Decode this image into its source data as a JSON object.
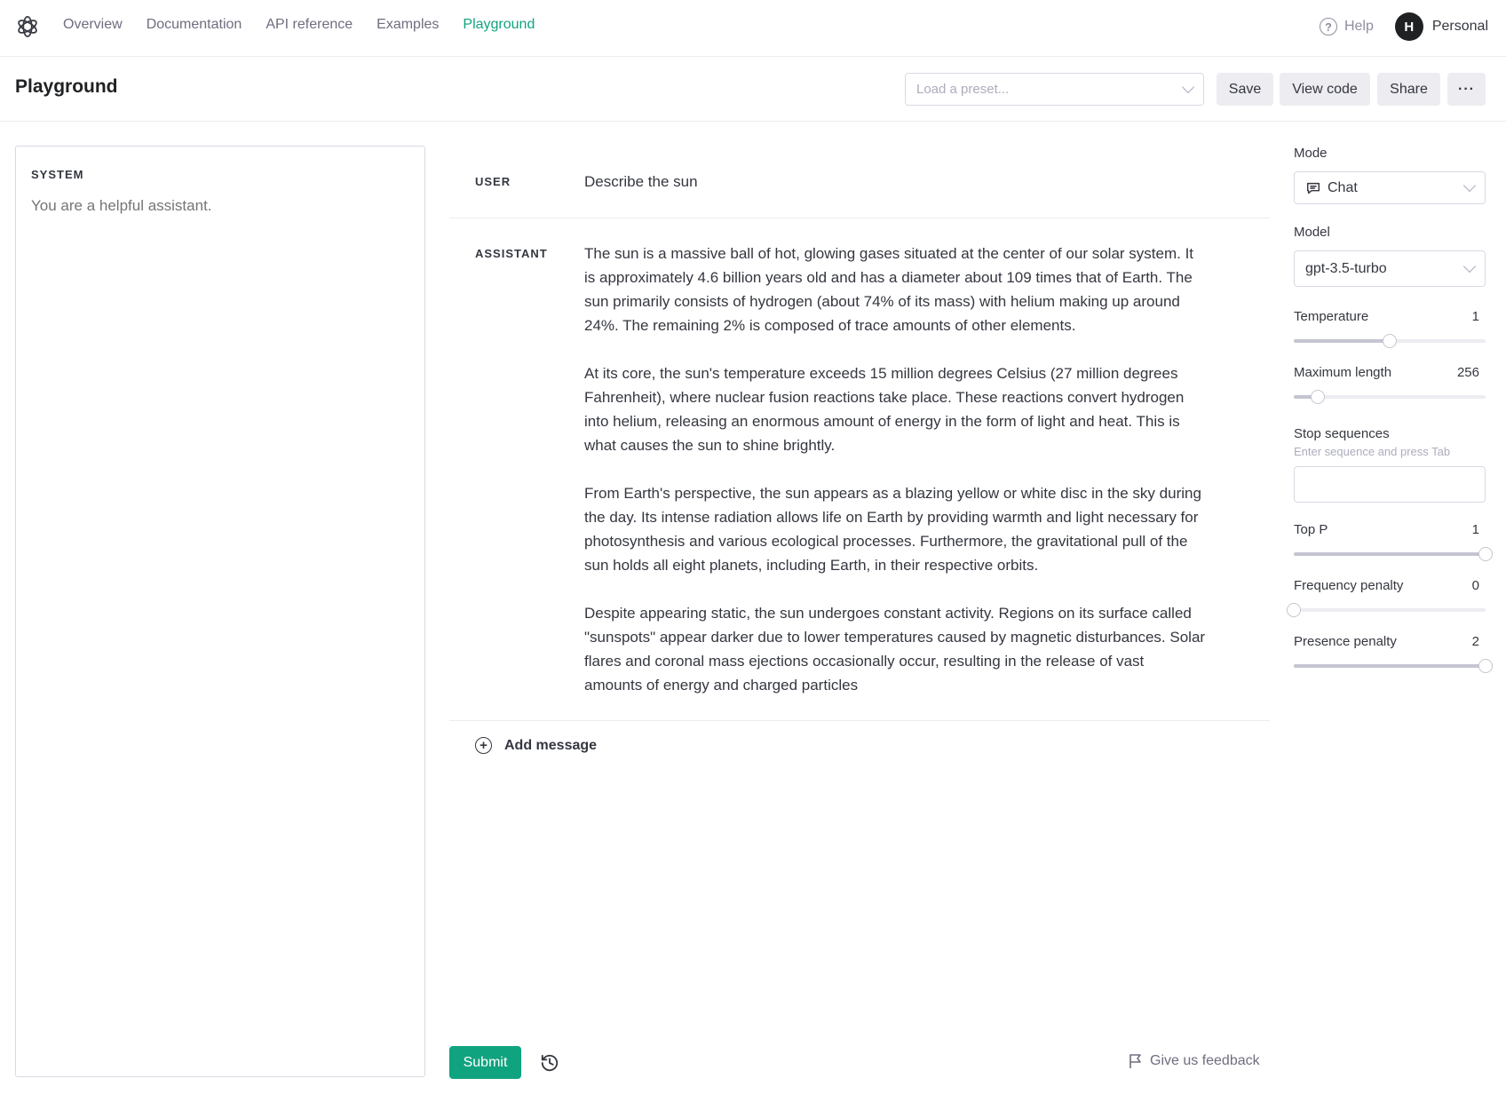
{
  "nav": {
    "logo": "openai-logo",
    "links": [
      {
        "label": "Overview",
        "active": false
      },
      {
        "label": "Documentation",
        "active": false
      },
      {
        "label": "API reference",
        "active": false
      },
      {
        "label": "Examples",
        "active": false
      },
      {
        "label": "Playground",
        "active": true
      }
    ],
    "help_label": "Help",
    "help_icon": "question-circle-icon",
    "avatar_initial": "H",
    "account_label": "Personal"
  },
  "header": {
    "title": "Playground",
    "preset_placeholder": "Load a preset...",
    "save_label": "Save",
    "view_code_label": "View code",
    "share_label": "Share",
    "more_label": "···"
  },
  "system": {
    "label": "SYSTEM",
    "placeholder": "You are a helpful assistant.",
    "value": ""
  },
  "conversation": {
    "messages": [
      {
        "role": "USER",
        "content": [
          "Describe the sun"
        ]
      },
      {
        "role": "ASSISTANT",
        "content": [
          "The sun is a massive ball of hot, glowing gases situated at the center of our solar system. It is approximately 4.6 billion years old and has a diameter about 109 times that of Earth. The sun primarily consists of hydrogen (about 74% of its mass) with helium making up around 24%. The remaining 2% is composed of trace amounts of other elements.",
          "At its core, the sun's temperature exceeds 15 million degrees Celsius (27 million degrees Fahrenheit), where nuclear fusion reactions take place. These reactions convert hydrogen into helium, releasing an enormous amount of energy in the form of light and heat. This is what causes the sun to shine brightly.",
          "From Earth's perspective, the sun appears as a blazing yellow or white disc in the sky during the day. Its intense radiation allows life on Earth by providing warmth and light necessary for photosynthesis and various ecological processes. Furthermore, the gravitational pull of the sun holds all eight planets, including Earth, in their respective orbits.",
          "Despite appearing static, the sun undergoes constant activity. Regions on its surface called \"sunspots\" appear darker due to lower temperatures caused by magnetic disturbances. Solar flares and coronal mass ejections occasionally occur, resulting in the release of vast amounts of energy and charged particles"
        ]
      }
    ],
    "add_message_label": "Add message"
  },
  "footer": {
    "submit_label": "Submit",
    "feedback_label": "Give us feedback"
  },
  "settings": {
    "mode": {
      "label": "Mode",
      "value": "Chat"
    },
    "model": {
      "label": "Model",
      "value": "gpt-3.5-turbo"
    },
    "temperature": {
      "label": "Temperature",
      "value": "1",
      "fraction": 0.5
    },
    "max_length": {
      "label": "Maximum length",
      "value": "256",
      "fraction": 0.125
    },
    "stop_sequences": {
      "label": "Stop sequences",
      "hint": "Enter sequence and press Tab",
      "value": ""
    },
    "top_p": {
      "label": "Top P",
      "value": "1",
      "fraction": 1.0
    },
    "frequency_penalty": {
      "label": "Frequency penalty",
      "value": "0",
      "fraction": 0.0
    },
    "presence_penalty": {
      "label": "Presence penalty",
      "value": "2",
      "fraction": 1.0
    }
  },
  "colors": {
    "accent": "#10a37f",
    "text": "#353740",
    "muted": "#6e6e80",
    "border": "#d9d9e3"
  }
}
